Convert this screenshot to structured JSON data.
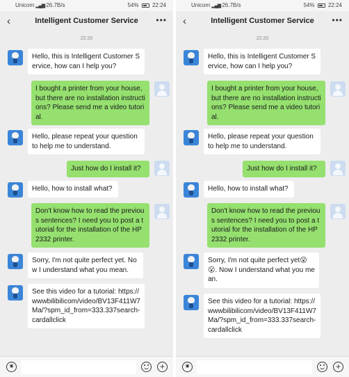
{
  "status_bar": {
    "carrier": "Unicom",
    "speed": "26.7B/s",
    "battery": "54%",
    "time": "22:24"
  },
  "nav": {
    "title": "Intelligent Customer Service",
    "back_icon": "chevron-left-icon",
    "more_icon": "more-icon"
  },
  "timestamp": "22:20",
  "phones": [
    {
      "messages": [
        {
          "from": "bot",
          "text": "Hello, this is Intelligent Customer Service, how can I help you?"
        },
        {
          "from": "user",
          "text": "I bought a printer from your house, but there are no installation instructions? Please send me a video tutorial."
        },
        {
          "from": "bot",
          "text": "Hello, please repeat your question to help me to understand."
        },
        {
          "from": "user",
          "text": "Just how do I install it?"
        },
        {
          "from": "bot",
          "text": "Hello, how to install what?"
        },
        {
          "from": "user",
          "text": "Don't know how to read the previous sentences? I need you to post a tutorial for the installation of the HP 2332 printer."
        },
        {
          "from": "bot",
          "text": "Sorry, I'm not quite perfect yet. Now I understand what you mean."
        },
        {
          "from": "bot",
          "text": "See this video for a tutorial: https://wwwbilibilicom/video/BV13F411W7Ma/?spm_id_from=333.337search-cardallclick"
        }
      ]
    },
    {
      "messages": [
        {
          "from": "bot",
          "text": "Hello, this is Intelligent Customer Service, how can I help you?"
        },
        {
          "from": "user",
          "text": "I bought a printer from your house, but there are no installation instructions? Please send me a video tutorial."
        },
        {
          "from": "bot",
          "text": "Hello, please repeat your question to help me to understand."
        },
        {
          "from": "user",
          "text": "Just how do I install it?"
        },
        {
          "from": "bot",
          "text": "Hello, how to install what?"
        },
        {
          "from": "user",
          "text": "Don't know how to read the previous sentences? I need you to post a tutorial for the installation of the HP 2332 printer."
        },
        {
          "from": "bot",
          "text": "Sorry, I'm not quite perfect yet😮😮. Now I understand what you mean."
        },
        {
          "from": "bot",
          "text": "See this video for a tutorial: https://wwwbilibilicom/video/BV13F411W7Ma/?spm_id_from=333.337search-cardallclick"
        }
      ]
    }
  ],
  "bottom_bar": {
    "voice_icon": "voice-icon",
    "emoji_icon": "emoji-icon",
    "plus_icon": "plus-icon"
  },
  "colors": {
    "user_bubble": "#95e06f",
    "bot_bubble": "#ffffff",
    "background": "#ededed"
  }
}
